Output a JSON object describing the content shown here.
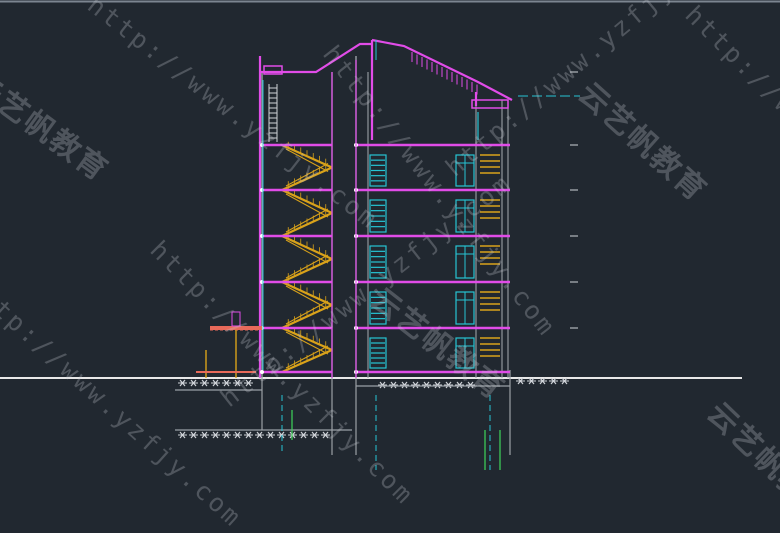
{
  "drawing": {
    "subject": "residential-building-section",
    "floors_above_ground": 5,
    "colors": {
      "background": "#212830",
      "slab": "#e14ce8",
      "stair": "#d9a21a",
      "window": "#26c4d4",
      "ground_line": "#e8e8e8",
      "hatch": "#cfd3d8",
      "dim_tick": "#cfd3d8",
      "axis": "#26c4d4",
      "wall": "#9aa0a6"
    }
  },
  "watermarks": {
    "url": "http://www.yzfjy.com",
    "brand": "云艺帆教育"
  }
}
